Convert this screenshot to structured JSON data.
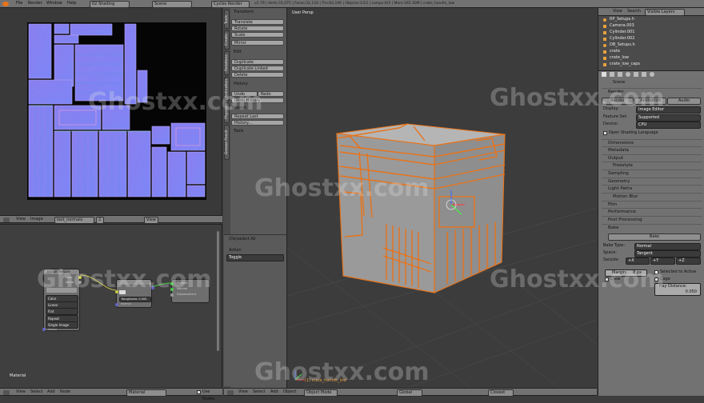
{
  "topbar": {
    "menus": [
      "File",
      "Render",
      "Window",
      "Help"
    ],
    "layout": "02 Shading",
    "scene": "Scene",
    "engine": "Cycles Render",
    "stats": "v2.79 | Verts:31,075 | Faces:31,134 | Tris:62,106 | Objects:1/12 | Lamps:0/3 | Mem:165.30M | crate_handle_low"
  },
  "uv_editor": {
    "header_menus": [
      "View",
      "Image"
    ],
    "image_name": "test_normals",
    "slot": "2",
    "view_label": "View"
  },
  "node_editor": {
    "label": "Material",
    "image_texture": {
      "title": "Image Texture",
      "outputs": [
        "Color",
        "Alpha"
      ],
      "fields": [
        "Color",
        "Linear",
        "Flat",
        "Repeat",
        "Single Image"
      ],
      "input": "Vector"
    },
    "normal_map": {
      "title": "",
      "field": "Roughness: 0.000",
      "input": "Normal"
    },
    "output": {
      "sockets": [
        "Surface",
        "Volume",
        "Displacement"
      ]
    },
    "header_menus": [
      "View",
      "Select",
      "Add",
      "Node"
    ],
    "material_field": "Material",
    "use_nodes": "Use Nodes"
  },
  "toolshelf": {
    "transform_title": "Transform",
    "transform_buttons": [
      "Translate",
      "Rotate",
      "Scale",
      "Mirror"
    ],
    "edit_title": "Edit",
    "edit_buttons": [
      "Duplicate",
      "Duplicate Linked",
      "Delete"
    ],
    "history_title": "History",
    "undo": "Undo",
    "redo": "Redo",
    "history_buttons": [
      "Undo History",
      "Repeat Last",
      "History..."
    ],
    "repeat": "Repeat",
    "tools_title": "Tools",
    "operator_title": "(De)select All",
    "action_label": "Action",
    "action_value": "Toggle",
    "vertical_tabs": [
      "Tools",
      "Create",
      "Relations",
      "Animation",
      "Physics",
      "Grease Pencil"
    ]
  },
  "viewport": {
    "label": "User Persp",
    "object_label": "(1) crate_handle_low",
    "header_menus": [
      "View",
      "Select",
      "Add",
      "Object"
    ],
    "mode": "Object Mode",
    "orientation": "Global",
    "snap": "Closest"
  },
  "outliner": {
    "header": [
      "View",
      "Search",
      "Visible Layers"
    ],
    "items": [
      "RP_Setups.h",
      "Camera.003",
      "Cylinder.001",
      "Cylinder.002",
      "DB_Setups.h",
      "crate",
      "crate_low",
      "crate_low_caps"
    ]
  },
  "properties": {
    "scene_label": "Scene",
    "render_title": "Render",
    "render_buttons": [
      "Render",
      "Animation",
      "Audio"
    ],
    "display_label": "Display:",
    "display_value": "Image Editor",
    "feature_set_label": "Feature Set:",
    "feature_set_value": "Supported",
    "device_label": "Device:",
    "device_value": "CPU",
    "osl_label": "Open Shading Language",
    "sections": [
      "Dimensions",
      "Metadata",
      "Output",
      "Freestyle",
      "Sampling",
      "Geometry",
      "Light Paths",
      "Motion Blur",
      "Film",
      "Performance",
      "Post Processing"
    ],
    "bake_title": "Bake",
    "bake_button": "Bake",
    "bake_type_label": "Bake Type:",
    "bake_type_value": "Normal",
    "space_label": "Space:",
    "space_value": "Tangent",
    "swizzle_label": "Swizzle:",
    "swizzle": [
      "+X",
      "+Y",
      "+Z"
    ],
    "margin": "Margin:",
    "margin_value": "8 px",
    "clear": "Clear",
    "selected_to_active": "Selected to Active",
    "cage": "Cage",
    "ray_distance": "Ray Distance:",
    "ray_distance_value": "0.050"
  },
  "watermark": "Ghostxx.com",
  "colors": {
    "accent": "#e8731a",
    "panel": "#727272",
    "viewport": "#3c3c3c"
  }
}
